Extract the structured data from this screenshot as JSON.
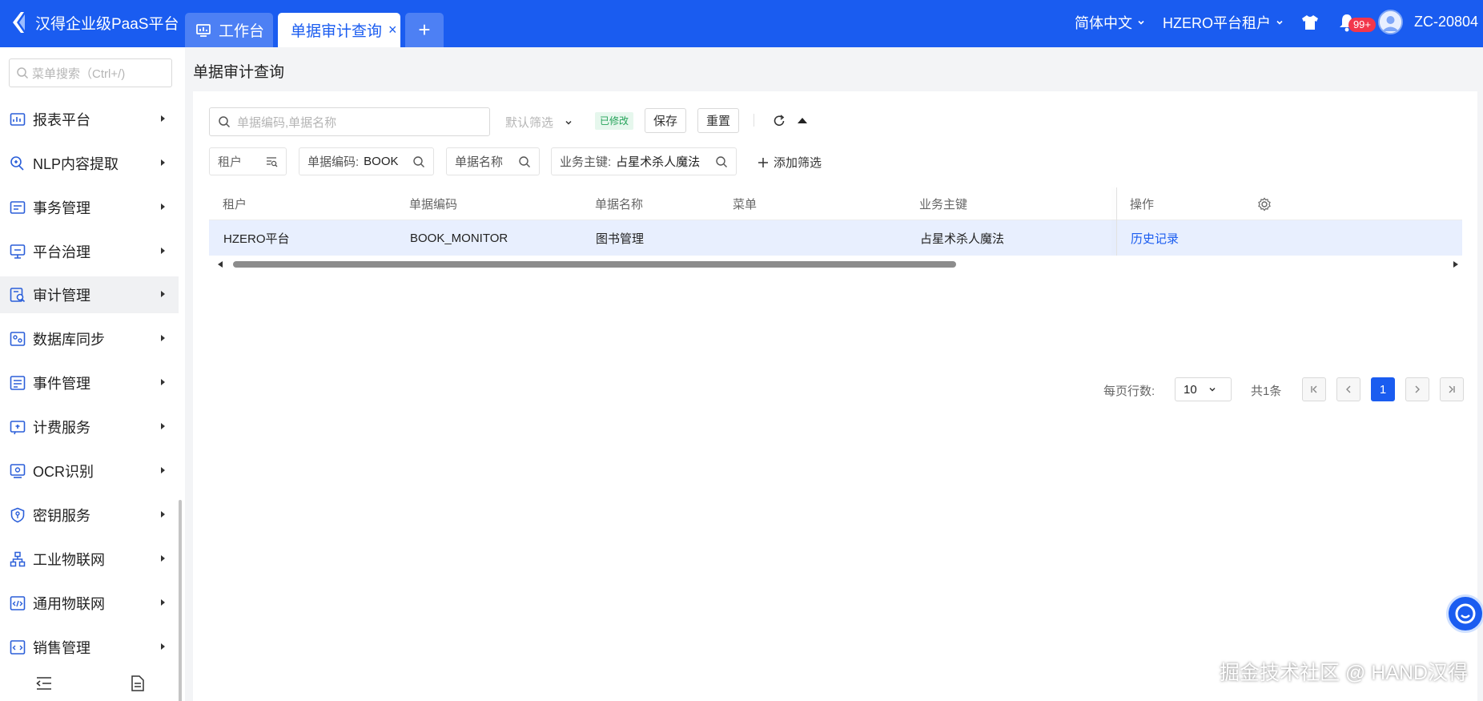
{
  "app": {
    "title": "汉得企业级PaaS平台"
  },
  "tabs": {
    "workbench": "工作台",
    "active": "单据审计查询",
    "close": "×",
    "add": "+"
  },
  "topbar": {
    "language": "简体中文",
    "tenant": "HZERO平台租户",
    "badge": "99+",
    "user": "ZC-20804"
  },
  "sidebar": {
    "search_placeholder": "菜单搜索（Ctrl+/)",
    "items": [
      {
        "label": "报表平台",
        "icon": "report-icon"
      },
      {
        "label": "NLP内容提取",
        "icon": "nlp-icon"
      },
      {
        "label": "事务管理",
        "icon": "transaction-icon"
      },
      {
        "label": "平台治理",
        "icon": "governance-icon"
      },
      {
        "label": "审计管理",
        "icon": "audit-icon",
        "active": true
      },
      {
        "label": "数据库同步",
        "icon": "database-sync-icon"
      },
      {
        "label": "事件管理",
        "icon": "event-icon"
      },
      {
        "label": "计费服务",
        "icon": "billing-icon"
      },
      {
        "label": "OCR识别",
        "icon": "ocr-icon"
      },
      {
        "label": "密钥服务",
        "icon": "key-icon"
      },
      {
        "label": "工业物联网",
        "icon": "iiot-icon"
      },
      {
        "label": "通用物联网",
        "icon": "iot-icon"
      },
      {
        "label": "销售管理",
        "icon": "sales-icon"
      }
    ]
  },
  "page": {
    "title": "单据审计查询"
  },
  "toolbar": {
    "search_placeholder": "单据编码,单据名称",
    "filter_select": "默认筛选",
    "modified_tag": "已修改",
    "save": "保存",
    "reset": "重置"
  },
  "filters": {
    "tenant": "租户",
    "code_label": "单据编码:",
    "code_value": "BOOK",
    "name": "单据名称",
    "key_label": "业务主键:",
    "key_value": "占星术杀人魔法",
    "add_filter": "添加筛选"
  },
  "table": {
    "columns": [
      "租户",
      "单据编码",
      "单据名称",
      "菜单",
      "业务主键",
      "操作"
    ],
    "rows": [
      {
        "tenant": "HZERO平台",
        "code": "BOOK_MONITOR",
        "name": "图书管理",
        "menu": "",
        "key": "占星术杀人魔法",
        "action": "历史记录"
      }
    ]
  },
  "pagination": {
    "page_size_label": "每页行数:",
    "page_size": "10",
    "total": "共1条",
    "current_page": "1"
  },
  "watermark": "掘金技术社区 @ HAND汉得",
  "colors": {
    "primary": "#1a5cf0",
    "tab_inactive": "#4d80f4",
    "row_selected": "#e8effe",
    "tag_green": "#25a35a",
    "badge_red": "#f2364b"
  }
}
